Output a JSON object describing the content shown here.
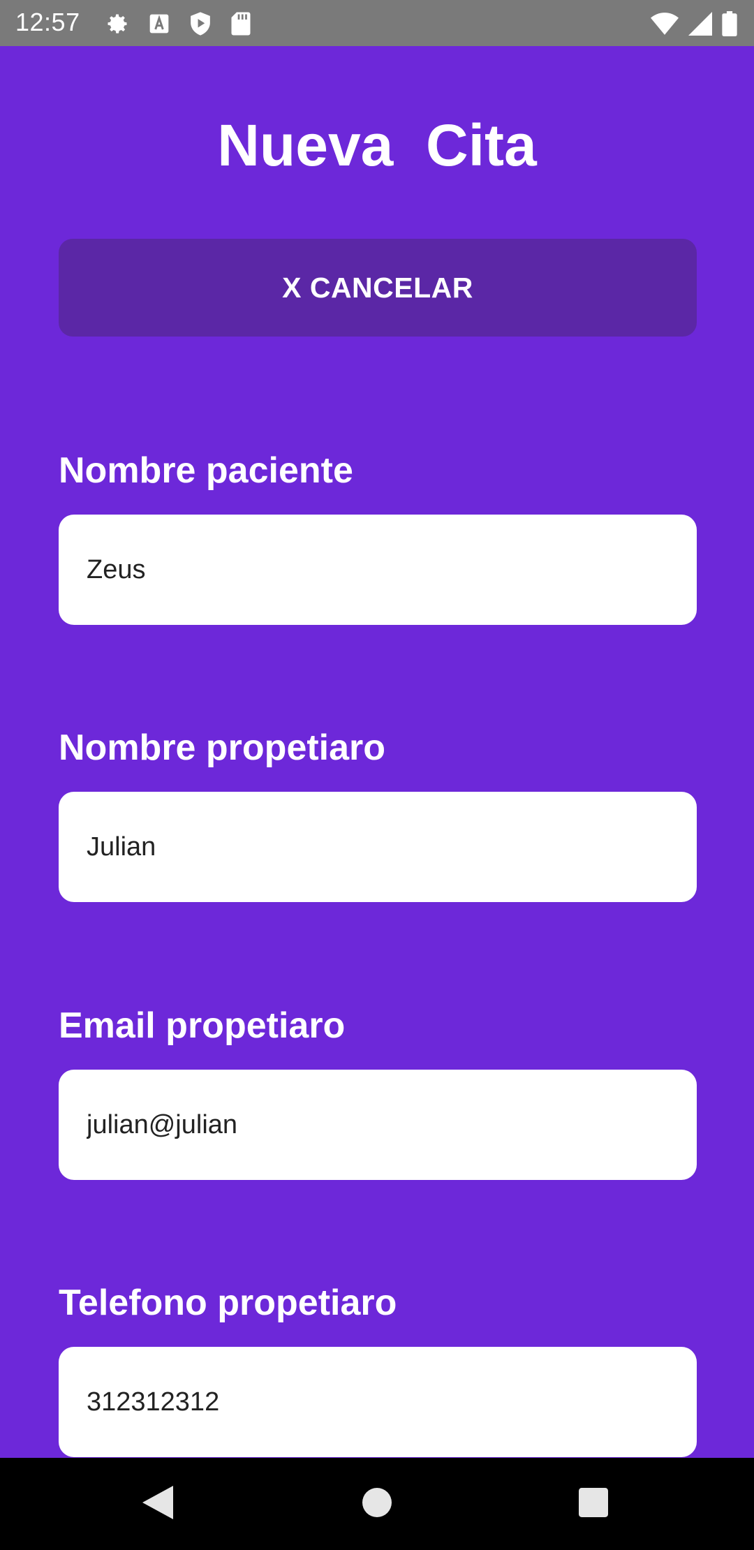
{
  "status_bar": {
    "time": "12:57",
    "left_icons": [
      "gear-icon",
      "a-icon",
      "shield-play-icon",
      "sd-card-icon"
    ],
    "right_icons": [
      "wifi-icon",
      "signal-icon",
      "battery-icon"
    ]
  },
  "page": {
    "title": "Nueva  Cita",
    "cancel_label": "X CANCELAR"
  },
  "form": {
    "fields": [
      {
        "label": "Nombre paciente",
        "value": "Zeus"
      },
      {
        "label": "Nombre propetiaro",
        "value": "Julian"
      },
      {
        "label": "Email propetiaro",
        "value": "julian@julian"
      },
      {
        "label": "Telefono propetiaro",
        "value": "312312312"
      }
    ]
  },
  "nav_bar": {
    "icons": [
      "back-icon",
      "home-icon",
      "recents-icon"
    ]
  },
  "colors": {
    "background": "#6d28d9",
    "button": "#5b27a6",
    "status_bar": "#7a7a7a",
    "nav_bar": "#000000"
  }
}
